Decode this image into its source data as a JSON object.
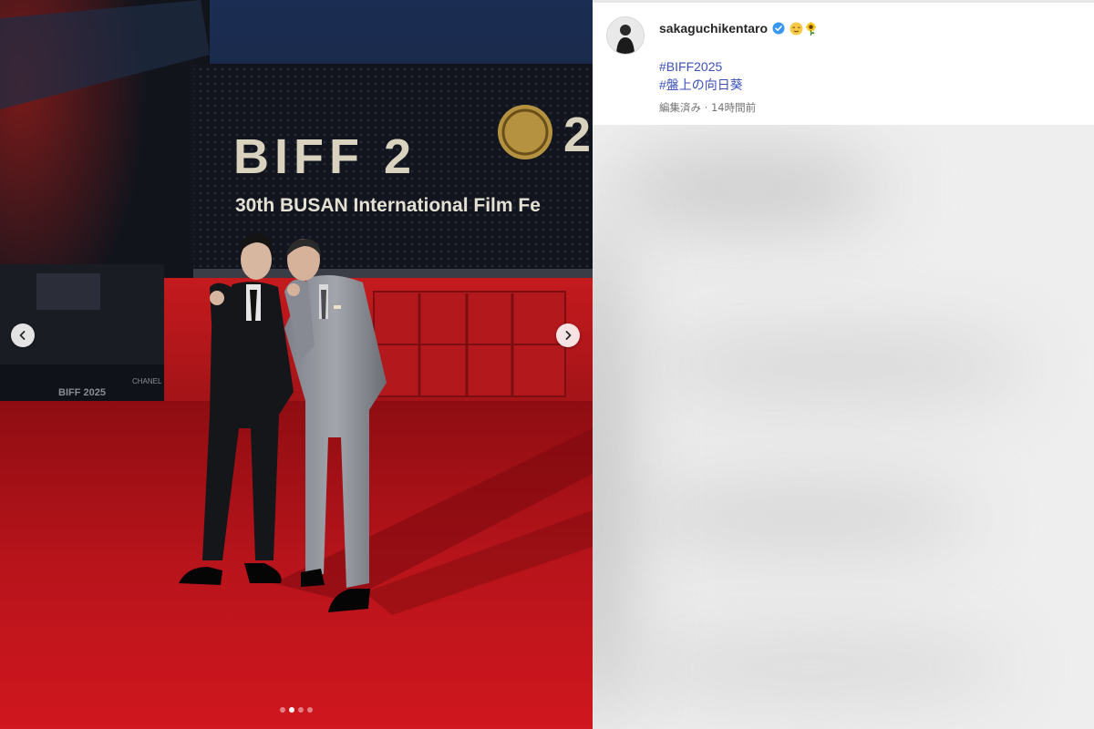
{
  "post": {
    "username": "sakaguchikentaro",
    "verified": true,
    "emojis": [
      "relieved-face-icon",
      "sunflower-icon"
    ],
    "hashtags": [
      "#BIFF2025",
      "#盤上の向日葵"
    ],
    "edited_label": "編集済み",
    "separator": "·",
    "time_ago": "14時間前"
  },
  "photo": {
    "sign_main": "BIFF 2",
    "sign_trail": "2",
    "sign_sub": "30th BUSAN International Film Fe",
    "side_sign": "BIFF 2025",
    "side_brand": "CHANEL",
    "carousel": {
      "count": 4,
      "active_index": 1
    }
  },
  "colors": {
    "carpet": "#c0131a",
    "hashtag": "#3b4fb8",
    "verified": "#3897f0"
  }
}
